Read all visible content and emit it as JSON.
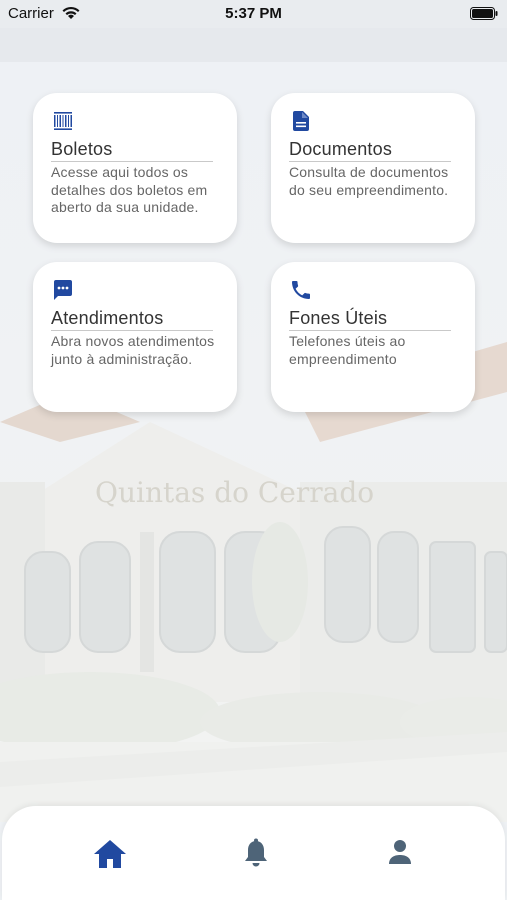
{
  "status_bar": {
    "carrier": "Carrier",
    "time": "5:37 PM"
  },
  "cards": {
    "boletos": {
      "icon": "barcode-icon",
      "title": "Boletos",
      "description": "Acesse aqui todos os detalhes dos boletos em aberto da sua unidade."
    },
    "documentos": {
      "icon": "document-icon",
      "title": "Documentos",
      "description": "Consulta de documentos do seu empreendimento."
    },
    "atendimentos": {
      "icon": "chat-icon",
      "title": "Atendimentos",
      "description": "Abra novos atendimentos junto à administração."
    },
    "fones": {
      "icon": "phone-icon",
      "title": "Fones Úteis",
      "description": "Telefones úteis ao empreendimento"
    }
  },
  "tab_bar": {
    "tabs": [
      {
        "name": "home",
        "icon": "home-icon",
        "active": true
      },
      {
        "name": "notifications",
        "icon": "bell-icon",
        "active": false
      },
      {
        "name": "profile",
        "icon": "user-icon",
        "active": false
      }
    ]
  },
  "colors": {
    "accent": "#2149a0",
    "inactive_icon": "#4e6478",
    "card_background": "#ffffff",
    "page_background": "#eef1f4"
  },
  "background_image": {
    "signage": "Quintas do Cerrado"
  }
}
